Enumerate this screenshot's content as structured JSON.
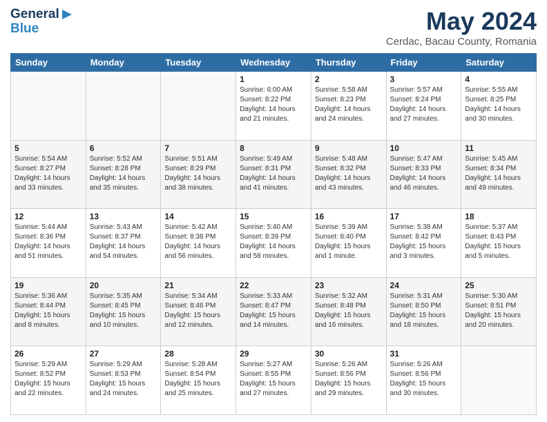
{
  "header": {
    "logo_line1": "General",
    "logo_line2": "Blue",
    "month": "May 2024",
    "location": "Cerdac, Bacau County, Romania"
  },
  "days_of_week": [
    "Sunday",
    "Monday",
    "Tuesday",
    "Wednesday",
    "Thursday",
    "Friday",
    "Saturday"
  ],
  "weeks": [
    [
      {
        "day": "",
        "sunrise": "",
        "sunset": "",
        "daylight": ""
      },
      {
        "day": "",
        "sunrise": "",
        "sunset": "",
        "daylight": ""
      },
      {
        "day": "",
        "sunrise": "",
        "sunset": "",
        "daylight": ""
      },
      {
        "day": "1",
        "sunrise": "Sunrise: 6:00 AM",
        "sunset": "Sunset: 8:22 PM",
        "daylight": "Daylight: 14 hours and 21 minutes."
      },
      {
        "day": "2",
        "sunrise": "Sunrise: 5:58 AM",
        "sunset": "Sunset: 8:23 PM",
        "daylight": "Daylight: 14 hours and 24 minutes."
      },
      {
        "day": "3",
        "sunrise": "Sunrise: 5:57 AM",
        "sunset": "Sunset: 8:24 PM",
        "daylight": "Daylight: 14 hours and 27 minutes."
      },
      {
        "day": "4",
        "sunrise": "Sunrise: 5:55 AM",
        "sunset": "Sunset: 8:25 PM",
        "daylight": "Daylight: 14 hours and 30 minutes."
      }
    ],
    [
      {
        "day": "5",
        "sunrise": "Sunrise: 5:54 AM",
        "sunset": "Sunset: 8:27 PM",
        "daylight": "Daylight: 14 hours and 33 minutes."
      },
      {
        "day": "6",
        "sunrise": "Sunrise: 5:52 AM",
        "sunset": "Sunset: 8:28 PM",
        "daylight": "Daylight: 14 hours and 35 minutes."
      },
      {
        "day": "7",
        "sunrise": "Sunrise: 5:51 AM",
        "sunset": "Sunset: 8:29 PM",
        "daylight": "Daylight: 14 hours and 38 minutes."
      },
      {
        "day": "8",
        "sunrise": "Sunrise: 5:49 AM",
        "sunset": "Sunset: 8:31 PM",
        "daylight": "Daylight: 14 hours and 41 minutes."
      },
      {
        "day": "9",
        "sunrise": "Sunrise: 5:48 AM",
        "sunset": "Sunset: 8:32 PM",
        "daylight": "Daylight: 14 hours and 43 minutes."
      },
      {
        "day": "10",
        "sunrise": "Sunrise: 5:47 AM",
        "sunset": "Sunset: 8:33 PM",
        "daylight": "Daylight: 14 hours and 46 minutes."
      },
      {
        "day": "11",
        "sunrise": "Sunrise: 5:45 AM",
        "sunset": "Sunset: 8:34 PM",
        "daylight": "Daylight: 14 hours and 49 minutes."
      }
    ],
    [
      {
        "day": "12",
        "sunrise": "Sunrise: 5:44 AM",
        "sunset": "Sunset: 8:36 PM",
        "daylight": "Daylight: 14 hours and 51 minutes."
      },
      {
        "day": "13",
        "sunrise": "Sunrise: 5:43 AM",
        "sunset": "Sunset: 8:37 PM",
        "daylight": "Daylight: 14 hours and 54 minutes."
      },
      {
        "day": "14",
        "sunrise": "Sunrise: 5:42 AM",
        "sunset": "Sunset: 8:38 PM",
        "daylight": "Daylight: 14 hours and 56 minutes."
      },
      {
        "day": "15",
        "sunrise": "Sunrise: 5:40 AM",
        "sunset": "Sunset: 8:39 PM",
        "daylight": "Daylight: 14 hours and 58 minutes."
      },
      {
        "day": "16",
        "sunrise": "Sunrise: 5:39 AM",
        "sunset": "Sunset: 8:40 PM",
        "daylight": "Daylight: 15 hours and 1 minute."
      },
      {
        "day": "17",
        "sunrise": "Sunrise: 5:38 AM",
        "sunset": "Sunset: 8:42 PM",
        "daylight": "Daylight: 15 hours and 3 minutes."
      },
      {
        "day": "18",
        "sunrise": "Sunrise: 5:37 AM",
        "sunset": "Sunset: 8:43 PM",
        "daylight": "Daylight: 15 hours and 5 minutes."
      }
    ],
    [
      {
        "day": "19",
        "sunrise": "Sunrise: 5:36 AM",
        "sunset": "Sunset: 8:44 PM",
        "daylight": "Daylight: 15 hours and 8 minutes."
      },
      {
        "day": "20",
        "sunrise": "Sunrise: 5:35 AM",
        "sunset": "Sunset: 8:45 PM",
        "daylight": "Daylight: 15 hours and 10 minutes."
      },
      {
        "day": "21",
        "sunrise": "Sunrise: 5:34 AM",
        "sunset": "Sunset: 8:46 PM",
        "daylight": "Daylight: 15 hours and 12 minutes."
      },
      {
        "day": "22",
        "sunrise": "Sunrise: 5:33 AM",
        "sunset": "Sunset: 8:47 PM",
        "daylight": "Daylight: 15 hours and 14 minutes."
      },
      {
        "day": "23",
        "sunrise": "Sunrise: 5:32 AM",
        "sunset": "Sunset: 8:48 PM",
        "daylight": "Daylight: 15 hours and 16 minutes."
      },
      {
        "day": "24",
        "sunrise": "Sunrise: 5:31 AM",
        "sunset": "Sunset: 8:50 PM",
        "daylight": "Daylight: 15 hours and 18 minutes."
      },
      {
        "day": "25",
        "sunrise": "Sunrise: 5:30 AM",
        "sunset": "Sunset: 8:51 PM",
        "daylight": "Daylight: 15 hours and 20 minutes."
      }
    ],
    [
      {
        "day": "26",
        "sunrise": "Sunrise: 5:29 AM",
        "sunset": "Sunset: 8:52 PM",
        "daylight": "Daylight: 15 hours and 22 minutes."
      },
      {
        "day": "27",
        "sunrise": "Sunrise: 5:29 AM",
        "sunset": "Sunset: 8:53 PM",
        "daylight": "Daylight: 15 hours and 24 minutes."
      },
      {
        "day": "28",
        "sunrise": "Sunrise: 5:28 AM",
        "sunset": "Sunset: 8:54 PM",
        "daylight": "Daylight: 15 hours and 25 minutes."
      },
      {
        "day": "29",
        "sunrise": "Sunrise: 5:27 AM",
        "sunset": "Sunset: 8:55 PM",
        "daylight": "Daylight: 15 hours and 27 minutes."
      },
      {
        "day": "30",
        "sunrise": "Sunrise: 5:26 AM",
        "sunset": "Sunset: 8:56 PM",
        "daylight": "Daylight: 15 hours and 29 minutes."
      },
      {
        "day": "31",
        "sunrise": "Sunrise: 5:26 AM",
        "sunset": "Sunset: 8:56 PM",
        "daylight": "Daylight: 15 hours and 30 minutes."
      },
      {
        "day": "",
        "sunrise": "",
        "sunset": "",
        "daylight": ""
      }
    ]
  ]
}
